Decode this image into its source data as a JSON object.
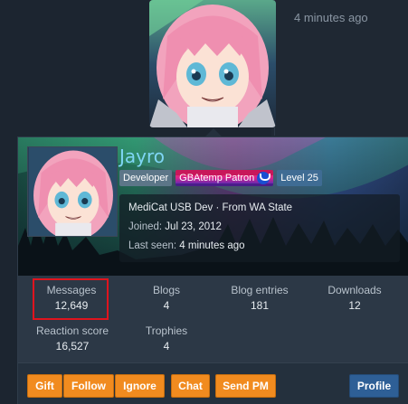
{
  "post": {
    "time": "4 minutes ago"
  },
  "member": {
    "username": "Jayro",
    "badges": {
      "developer": "Developer",
      "patron": "GBAtemp Patron",
      "level": "Level 25"
    },
    "info": {
      "title_line": "MediCat USB Dev · From WA State",
      "joined_label": "Joined:",
      "joined_value": "Jul 23, 2012",
      "last_seen_label": "Last seen:",
      "last_seen_value": "4 minutes ago"
    },
    "stats": [
      {
        "label": "Messages",
        "value": "12,649"
      },
      {
        "label": "Blogs",
        "value": "4"
      },
      {
        "label": "Blog entries",
        "value": "181"
      },
      {
        "label": "Downloads",
        "value": "12"
      },
      {
        "label": "Reaction score",
        "value": "16,527"
      },
      {
        "label": "Trophies",
        "value": "4"
      }
    ]
  },
  "actions": {
    "gift": "Gift",
    "follow": "Follow",
    "ignore": "Ignore",
    "chat": "Chat",
    "send_pm": "Send PM",
    "profile": "Profile"
  },
  "colors": {
    "accent_orange": "#f18b1f",
    "profile_blue": "#2e5f96",
    "username": "#7fd6f5",
    "highlight_red": "#e0141e"
  }
}
